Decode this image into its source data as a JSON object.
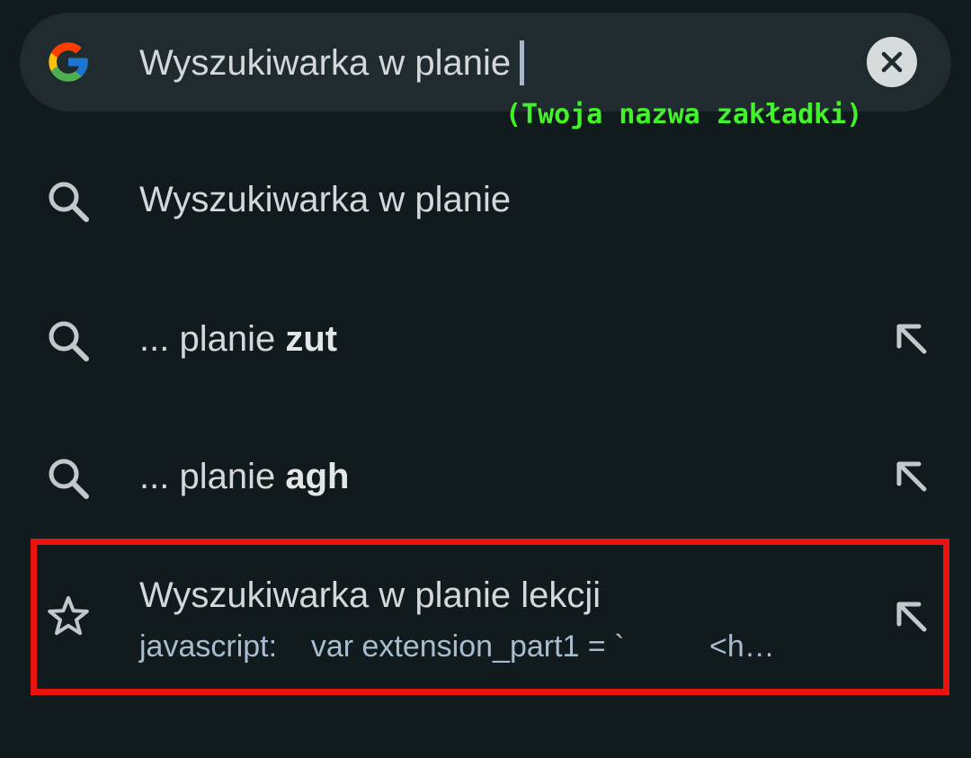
{
  "search_bar": {
    "logo": "google-g-icon",
    "query": "Wyszukiwarka w planie",
    "clear_icon": "close-icon"
  },
  "annotation": "(Twoja nazwa zakładki)",
  "suggestions": [
    {
      "icon": "search-icon",
      "prefix": "Wyszukiwarka w planie",
      "bold": "",
      "refine": false
    },
    {
      "icon": "search-icon",
      "prefix": "... planie ",
      "bold": "zut",
      "refine": true
    },
    {
      "icon": "search-icon",
      "prefix": "... planie ",
      "bold": "agh",
      "refine": true
    },
    {
      "icon": "star-icon",
      "title": "Wyszukiwarka w planie lekcji",
      "subtitle": "javascript:    var extension_part1 = `          <h…",
      "refine": true
    }
  ],
  "colors": {
    "background": "#111a1c",
    "search_bar": "#1f2b2e",
    "annotation": "#43f22b",
    "highlight_border": "#e8120f",
    "subtitle_text": "#a8bed0"
  }
}
